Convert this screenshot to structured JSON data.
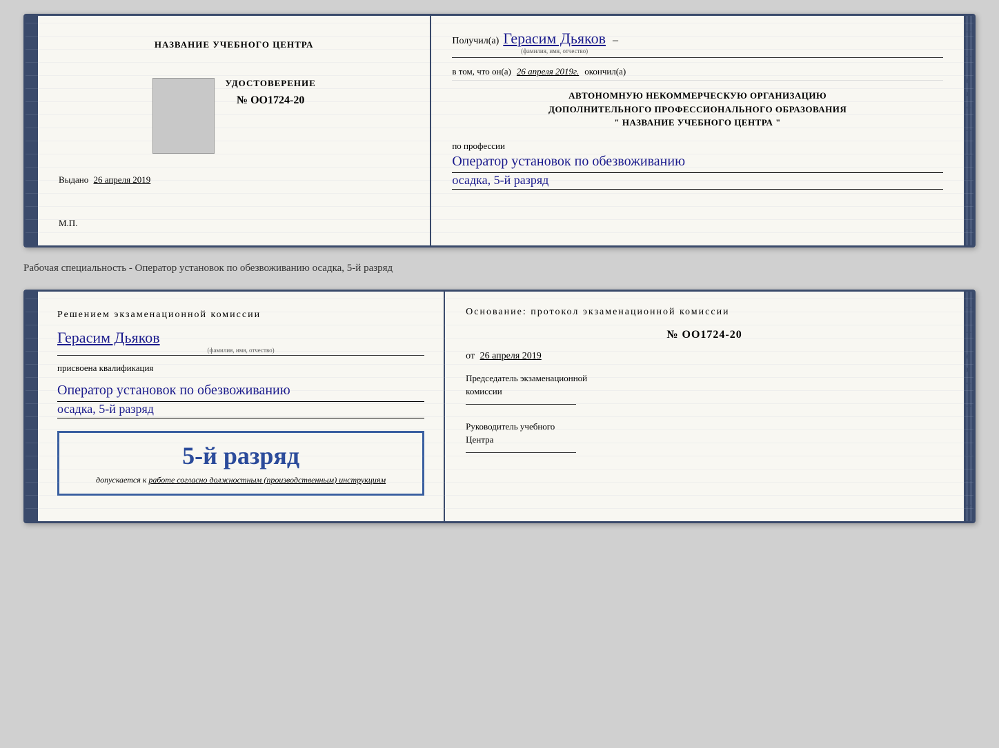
{
  "top_doc": {
    "left": {
      "title": "НАЗВАНИЕ УЧЕБНОГО ЦЕНТРА",
      "cert_title": "УДОСТОВЕРЕНИЕ",
      "cert_number": "№ OO1724-20",
      "issued_label": "Выдано",
      "issued_date": "26 апреля 2019",
      "mp_label": "М.П."
    },
    "right": {
      "received_label": "Получил(а)",
      "recipient_name": "Герасим Дьяков",
      "fio_sublabel": "(фамилия, имя, отчество)",
      "dash": "–",
      "confirmation_text": "в том, что он(а)",
      "date_text": "26 апреля 2019г.",
      "finished_label": "окончил(а)",
      "org_line1": "АВТОНОМНУЮ НЕКОММЕРЧЕСКУЮ ОРГАНИЗАЦИЮ",
      "org_line2": "ДОПОЛНИТЕЛЬНОГО ПРОФЕССИОНАЛЬНОГО ОБРАЗОВАНИЯ",
      "org_quote": "\"   НАЗВАНИЕ УЧЕБНОГО ЦЕНТРА   \"",
      "profession_label": "по профессии",
      "profession_value": "Оператор установок по обезвоживанию",
      "profession_line2": "осадка, 5-й разряд"
    }
  },
  "middle_label": "Рабочая специальность - Оператор установок по обезвоживанию осадка, 5-й разряд",
  "bottom_doc": {
    "left": {
      "decision_line1": "Решением экзаменационной комиссии",
      "recipient_name": "Герасим Дьяков",
      "fio_sublabel": "(фамилия, имя, отчество)",
      "qualification_label": "присвоена квалификация",
      "qualification_value1": "Оператор установок по обезвоживанию",
      "qualification_value2": "осадка, 5-й разряд",
      "rank_text": "5-й разряд",
      "admission_prefix": "допускается к",
      "admission_text": "работе согласно должностным (производственным) инструкциям"
    },
    "right": {
      "basis_label": "Основание: протокол экзаменационной комиссии",
      "protocol_number": "№  OO1724-20",
      "date_prefix": "от",
      "date_value": "26 апреля 2019",
      "chairman_line1": "Председатель экзаменационной",
      "chairman_line2": "комиссии",
      "director_line1": "Руководитель учебного",
      "director_line2": "Центра"
    }
  }
}
